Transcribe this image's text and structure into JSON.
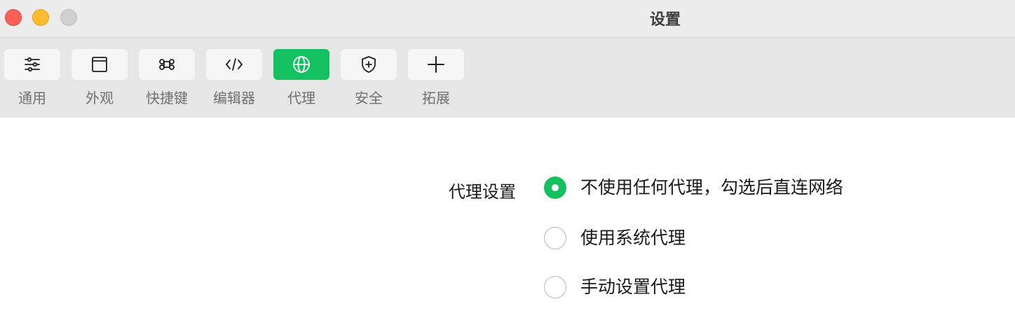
{
  "window": {
    "title": "设置"
  },
  "toolbar": {
    "tabs": [
      {
        "label": "通用",
        "icon": "sliders-icon",
        "active": false
      },
      {
        "label": "外观",
        "icon": "window-icon",
        "active": false
      },
      {
        "label": "快捷键",
        "icon": "command-key-icon",
        "active": false
      },
      {
        "label": "编辑器",
        "icon": "code-icon",
        "active": false
      },
      {
        "label": "代理",
        "icon": "globe-icon",
        "active": true
      },
      {
        "label": "安全",
        "icon": "shield-plus-icon",
        "active": false
      },
      {
        "label": "拓展",
        "icon": "plus-icon",
        "active": false
      }
    ]
  },
  "proxy": {
    "section_label": "代理设置",
    "options": [
      {
        "label": "不使用任何代理，勾选后直连网络",
        "checked": true
      },
      {
        "label": "使用系统代理",
        "checked": false
      },
      {
        "label": "手动设置代理",
        "checked": false
      }
    ]
  },
  "colors": {
    "accent": "#14c160",
    "toolbar_bg": "#e6e6e6",
    "titlebar_bg": "#ececec"
  }
}
